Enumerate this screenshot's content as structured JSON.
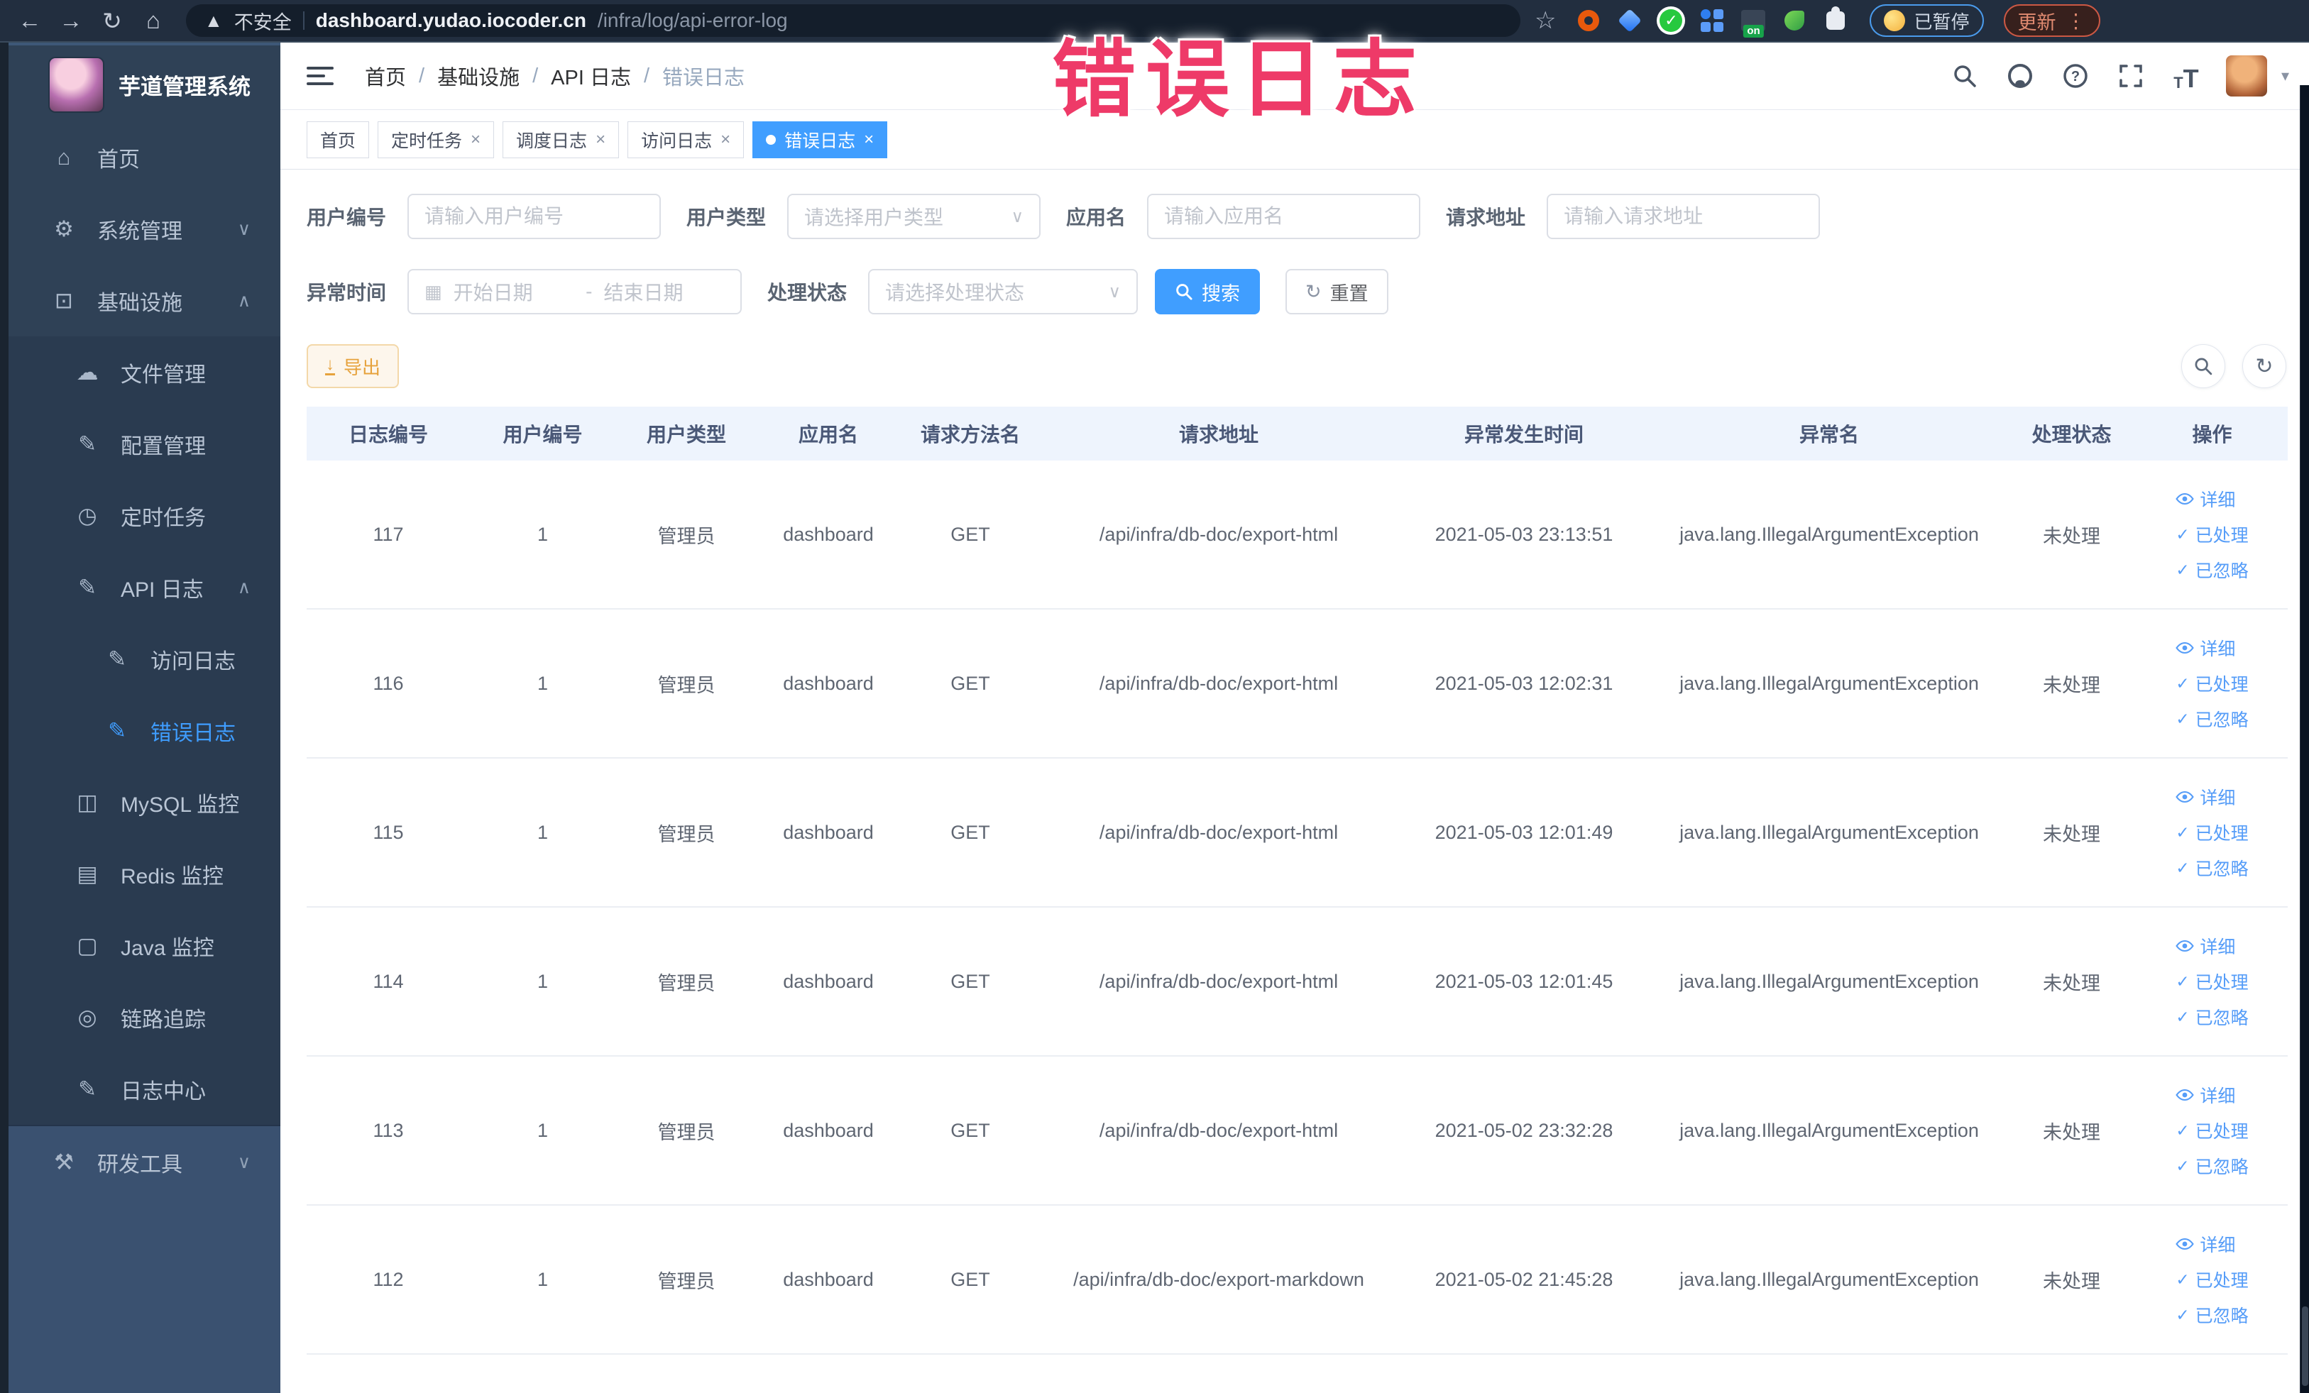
{
  "browser": {
    "security_label": "不安全",
    "url_host": "dashboard.yudao.iocoder.cn",
    "url_path": "/infra/log/api-error-log",
    "extension_on_badge": "on",
    "paused_badge_label": "已暂停",
    "update_button_label": "更新"
  },
  "overlay_title": "错误日志",
  "sidebar": {
    "logo_title": "芋道管理系统",
    "items": [
      {
        "key": "home",
        "label": "首页",
        "icon": "home-icon",
        "level": 1
      },
      {
        "key": "system-management",
        "label": "系统管理",
        "icon": "gear-icon",
        "level": 1,
        "chevron": "down"
      },
      {
        "key": "infrastructure",
        "label": "基础设施",
        "icon": "monitor-icon",
        "level": 1,
        "chevron": "up"
      },
      {
        "key": "file-management",
        "label": "文件管理",
        "icon": "cloud-upload-icon",
        "level": 2
      },
      {
        "key": "config-management",
        "label": "配置管理",
        "icon": "edit-icon",
        "level": 2
      },
      {
        "key": "scheduled-jobs",
        "label": "定时任务",
        "icon": "clock-icon",
        "level": 2
      },
      {
        "key": "api-log",
        "label": "API 日志",
        "icon": "log-icon",
        "level": 2,
        "chevron": "up"
      },
      {
        "key": "access-log",
        "label": "访问日志",
        "icon": "log-icon",
        "level": 3
      },
      {
        "key": "error-log",
        "label": "错误日志",
        "icon": "log-icon",
        "level": 3,
        "active": true
      },
      {
        "key": "mysql-monitor",
        "label": "MySQL 监控",
        "icon": "chart-icon",
        "level": 2
      },
      {
        "key": "redis-monitor",
        "label": "Redis 监控",
        "icon": "database-icon",
        "level": 2
      },
      {
        "key": "java-monitor",
        "label": "Java 监控",
        "icon": "java-monitor-icon",
        "level": 2
      },
      {
        "key": "trace",
        "label": "链路追踪",
        "icon": "trace-icon",
        "level": 2
      },
      {
        "key": "log-center",
        "label": "日志中心",
        "icon": "log-icon",
        "level": 2
      },
      {
        "key": "dev-tools",
        "label": "研发工具",
        "icon": "toolbox-icon",
        "level": 1,
        "chevron": "down",
        "section": "light"
      }
    ]
  },
  "breadcrumb": [
    "首页",
    "基础设施",
    "API 日志",
    "错误日志"
  ],
  "tags": [
    {
      "key": "home",
      "label": "首页",
      "closable": false,
      "active": false
    },
    {
      "key": "scheduled-jobs",
      "label": "定时任务",
      "closable": true,
      "active": false
    },
    {
      "key": "schedule-log",
      "label": "调度日志",
      "closable": true,
      "active": false
    },
    {
      "key": "access-log",
      "label": "访问日志",
      "closable": true,
      "active": false
    },
    {
      "key": "error-log",
      "label": "错误日志",
      "closable": true,
      "active": true
    }
  ],
  "filters": {
    "user_id": {
      "label": "用户编号",
      "placeholder": "请输入用户编号"
    },
    "user_type": {
      "label": "用户类型",
      "placeholder": "请选择用户类型"
    },
    "app_name": {
      "label": "应用名",
      "placeholder": "请输入应用名"
    },
    "request_url": {
      "label": "请求地址",
      "placeholder": "请输入请求地址"
    },
    "exception_time": {
      "label": "异常时间",
      "start_placeholder": "开始日期",
      "separator": "-",
      "end_placeholder": "结束日期"
    },
    "process_status": {
      "label": "处理状态",
      "placeholder": "请选择处理状态"
    },
    "search_button": "搜索",
    "reset_button": "重置"
  },
  "toolbar": {
    "export_button": "导出"
  },
  "table": {
    "columns": [
      "日志编号",
      "用户编号",
      "用户类型",
      "应用名",
      "请求方法名",
      "请求地址",
      "异常发生时间",
      "异常名",
      "处理状态",
      "操作"
    ],
    "actions": {
      "detail": "详细",
      "processed": "已处理",
      "ignored": "已忽略"
    },
    "rows": [
      {
        "log_id": "117",
        "user_id": "1",
        "user_type": "管理员",
        "app_name": "dashboard",
        "method": "GET",
        "url": "/api/infra/db-doc/export-html",
        "time": "2021-05-03 23:13:51",
        "exception": "java.lang.IllegalArgumentException",
        "status": "未处理"
      },
      {
        "log_id": "116",
        "user_id": "1",
        "user_type": "管理员",
        "app_name": "dashboard",
        "method": "GET",
        "url": "/api/infra/db-doc/export-html",
        "time": "2021-05-03 12:02:31",
        "exception": "java.lang.IllegalArgumentException",
        "status": "未处理"
      },
      {
        "log_id": "115",
        "user_id": "1",
        "user_type": "管理员",
        "app_name": "dashboard",
        "method": "GET",
        "url": "/api/infra/db-doc/export-html",
        "time": "2021-05-03 12:01:49",
        "exception": "java.lang.IllegalArgumentException",
        "status": "未处理"
      },
      {
        "log_id": "114",
        "user_id": "1",
        "user_type": "管理员",
        "app_name": "dashboard",
        "method": "GET",
        "url": "/api/infra/db-doc/export-html",
        "time": "2021-05-03 12:01:45",
        "exception": "java.lang.IllegalArgumentException",
        "status": "未处理"
      },
      {
        "log_id": "113",
        "user_id": "1",
        "user_type": "管理员",
        "app_name": "dashboard",
        "method": "GET",
        "url": "/api/infra/db-doc/export-html",
        "time": "2021-05-02 23:32:28",
        "exception": "java.lang.IllegalArgumentException",
        "status": "未处理"
      },
      {
        "log_id": "112",
        "user_id": "1",
        "user_type": "管理员",
        "app_name": "dashboard",
        "method": "GET",
        "url": "/api/infra/db-doc/export-markdown",
        "time": "2021-05-02 21:45:28",
        "exception": "java.lang.IllegalArgumentException",
        "status": "未处理"
      }
    ]
  },
  "colors": {
    "primary": "#409eff",
    "warning": "#e6a23c",
    "overlay_pink": "#ee3a68"
  }
}
